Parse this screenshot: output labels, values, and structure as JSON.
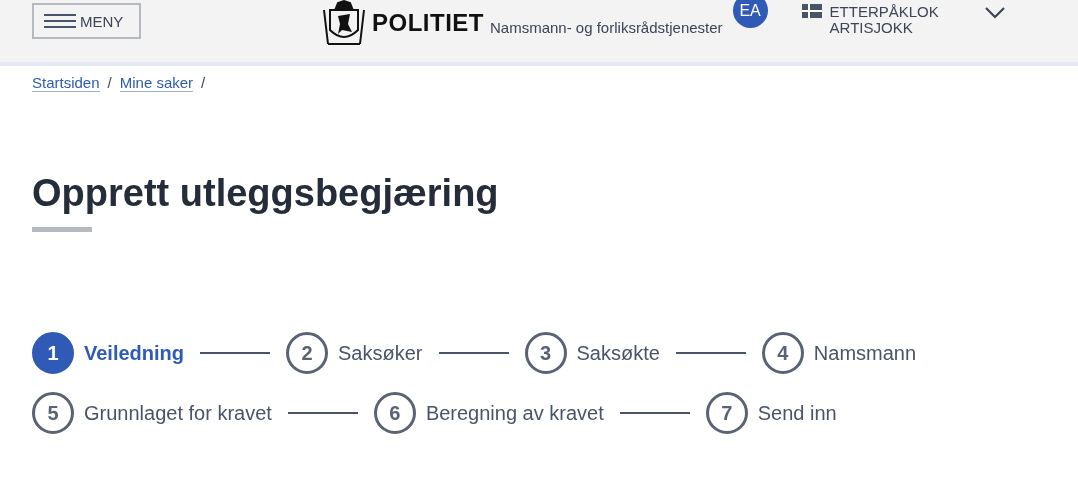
{
  "header": {
    "menu_button": "MENY",
    "logo_text": "POLITIET",
    "service_name": "Namsmann- og forliksrådstjenester",
    "user_initials": "EA",
    "user_name": "ETTERPÅKLOK ARTISJOKK"
  },
  "breadcrumbs": [
    {
      "label": "Startsiden",
      "kind": "link"
    },
    {
      "label": "Mine saker",
      "kind": "link"
    }
  ],
  "breadcrumb_separator": "/",
  "page_title": "Opprett utleggsbegjæring",
  "steps": [
    {
      "number": "1",
      "label": "Veiledning",
      "selected": true
    },
    {
      "number": "2",
      "label": "Saksøker",
      "selected": false
    },
    {
      "number": "3",
      "label": "Saksøkte",
      "selected": false
    },
    {
      "number": "4",
      "label": "Namsmann",
      "selected": false
    },
    {
      "number": "5",
      "label": "Grunnlaget for kravet",
      "selected": false
    },
    {
      "number": "6",
      "label": "Beregning av kravet",
      "selected": false
    },
    {
      "number": "7",
      "label": "Send inn",
      "selected": false
    }
  ]
}
